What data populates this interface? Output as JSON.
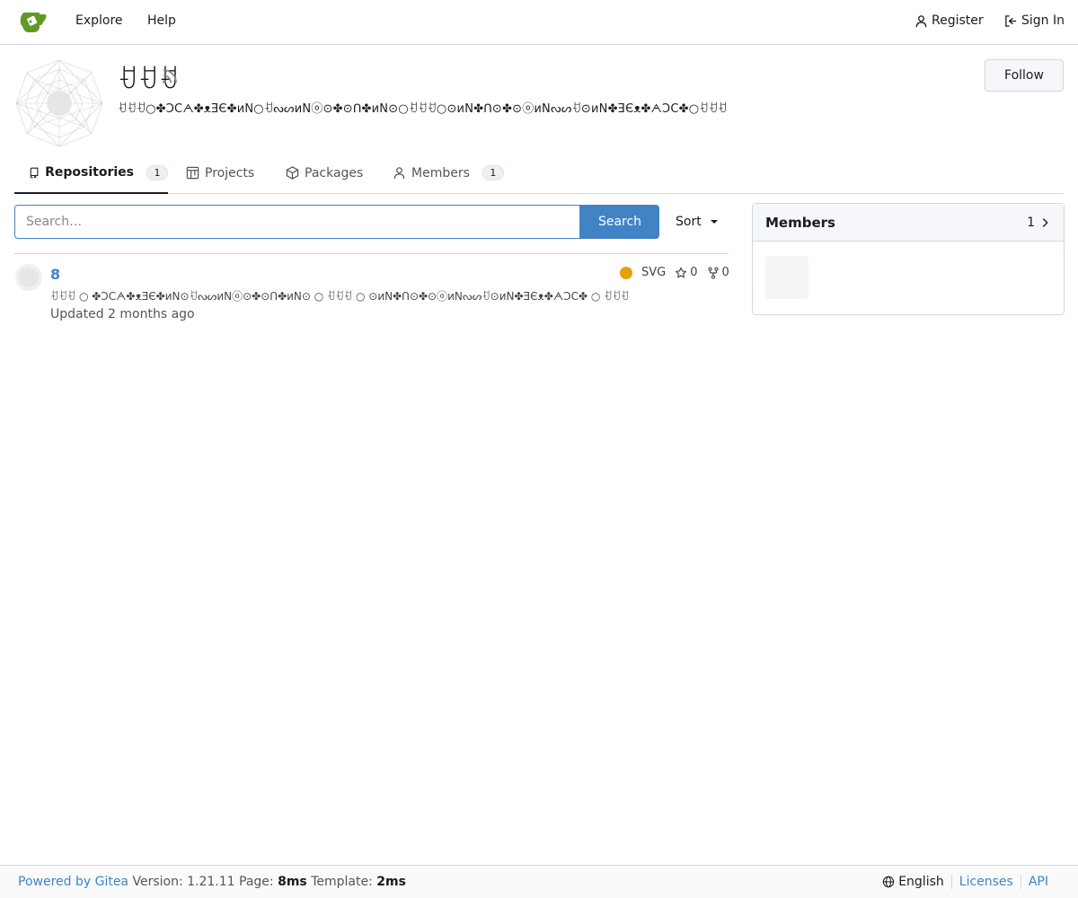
{
  "nav": {
    "explore": "Explore",
    "help": "Help",
    "register": "Register",
    "sign_in": "Sign In"
  },
  "org": {
    "name": "ꀀꀀꀀ",
    "description": "ꀀꀀꀀ○✤ↃⅭᗅ✤ᴥƎЄ✤ᴎN○ꀀᔓᔕᴎNⓞ⊙✤⊙ᑎ✤ᴎN⊙○ꀀꀀꀀ○⊙ᴎN✤ᑎ⊙✤⊙ⓞᴎNᔓᔕꀀ⊙ᴎN✤ƎЄᴥ✤ᗅↃⅭ✤○ꀀꀀꀀ",
    "follow": "Follow"
  },
  "tabs": {
    "repositories": "Repositories",
    "repositories_count": "1",
    "projects": "Projects",
    "packages": "Packages",
    "members": "Members",
    "members_count": "1"
  },
  "search": {
    "placeholder": "Search…",
    "button": "Search",
    "sort": "Sort"
  },
  "repo": {
    "name": "8",
    "language": "SVG",
    "language_color": "#e3a20a",
    "stars": "0",
    "forks": "0",
    "description": "ꀀꀀꀀ ○ ✤ↃⅭᗅ✤ᴥƎЄ✤ᴎN⊙ꀀᔓᔕᴎNⓞ⊙✤⊙ᑎ✤ᴎN⊙ ○ ꀀꀀꀀ ○ ⊙ᴎN✤ᑎ⊙✤⊙ⓞᴎNᔓᔕꀀ⊙ᴎN✤ƎЄᴥ✤ᗅↃⅭ✤ ○ ꀀꀀꀀ",
    "updated_prefix": "Updated",
    "updated": "2 months ago"
  },
  "members_panel": {
    "title": "Members",
    "count": "1"
  },
  "footer": {
    "powered_by": "Powered by Gitea",
    "version_label": "Version: 1.21.11 Page:",
    "page_time": "8ms",
    "template_label": "Template:",
    "template_time": "2ms",
    "language": "English",
    "licenses": "Licenses",
    "api": "API"
  },
  "colors": {
    "accent": "#4183c4",
    "logo_green": "#609926"
  }
}
